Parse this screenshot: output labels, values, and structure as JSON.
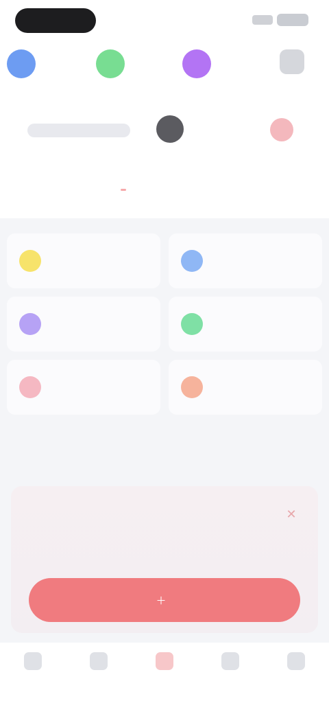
{
  "status_bar": {
    "left_pill": "",
    "right": ""
  },
  "categories": [
    {
      "label": "",
      "color": "#6d9cf2"
    },
    {
      "label": "",
      "color": "#78dd92"
    },
    {
      "label": "",
      "color": "#b374f4"
    },
    {
      "label": "",
      "color": "#d5d7dc"
    }
  ],
  "filter": {
    "picker_label": "",
    "chip_name": "",
    "avatar": "avatar"
  },
  "tabs": [
    {
      "label": "",
      "active": false
    },
    {
      "label": "",
      "active": true
    },
    {
      "label": "",
      "active": false
    },
    {
      "label": "",
      "active": false
    }
  ],
  "cards": [
    {
      "label": "",
      "color": "#f7e36b"
    },
    {
      "label": "",
      "color": "#8fb7f5"
    },
    {
      "label": "",
      "color": "#b6a2f5"
    },
    {
      "label": "",
      "color": "#7fe0a5"
    },
    {
      "label": "",
      "color": "#f5b8c2"
    },
    {
      "label": "",
      "color": "#f6b39c"
    }
  ],
  "section": {
    "title": ""
  },
  "promo": {
    "title": "",
    "description": "",
    "button_label": "",
    "close_icon": "close-icon"
  },
  "bottom_nav": [
    {
      "label": "",
      "active": false
    },
    {
      "label": "",
      "active": false
    },
    {
      "label": "",
      "active": true
    },
    {
      "label": "",
      "active": false
    },
    {
      "label": "",
      "active": false
    }
  ],
  "colors": {
    "accent": "#f07b7f",
    "background": "#f4f5f8"
  }
}
